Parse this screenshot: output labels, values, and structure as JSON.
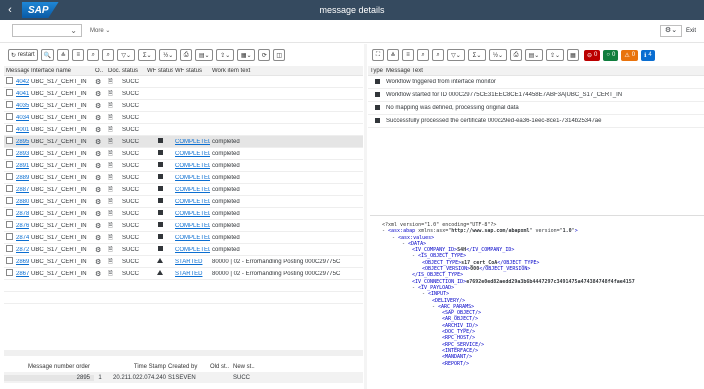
{
  "shell": {
    "title": "message details",
    "logo": "SAP",
    "back": "‹"
  },
  "subbar": {
    "dropdown_value": "",
    "more_label": "More",
    "exit_label": "Exit"
  },
  "left_toolbar": {
    "restart_label": "restart"
  },
  "grid": {
    "headers": [
      "Message",
      "Interface name",
      "O..",
      "Doc.",
      "status",
      "WF status",
      "WF status",
      "Work item text"
    ],
    "rows": [
      {
        "msg": "4042",
        "iface": "UBC_S17_CERT_IN",
        "status": "SUCC",
        "wf": "",
        "wfs": "",
        "text": "",
        "sel": false
      },
      {
        "msg": "4041",
        "iface": "UBC_S17_CERT_IN",
        "status": "SUCC",
        "wf": "",
        "wfs": "",
        "text": "",
        "sel": false
      },
      {
        "msg": "4035",
        "iface": "UBC_S17_CERT_IN",
        "status": "SUCC",
        "wf": "",
        "wfs": "",
        "text": "",
        "sel": false
      },
      {
        "msg": "4034",
        "iface": "UBC_S17_CERT_IN",
        "status": "SUCC",
        "wf": "",
        "wfs": "",
        "text": "",
        "sel": false
      },
      {
        "msg": "4001",
        "iface": "UBC_S17_CERT_IN",
        "status": "SUCC",
        "wf": "",
        "wfs": "",
        "text": "",
        "sel": false
      },
      {
        "msg": "2895",
        "iface": "UBC_S17_CERT_IN",
        "status": "SUCC",
        "wf": "sq",
        "wfs": "COMPLETED",
        "text": "completed",
        "sel": true
      },
      {
        "msg": "2893",
        "iface": "UBC_S17_CERT_IN",
        "status": "SUCC",
        "wf": "sq",
        "wfs": "COMPLETED",
        "text": "completed",
        "sel": false
      },
      {
        "msg": "2891",
        "iface": "UBC_S17_CERT_IN",
        "status": "SUCC",
        "wf": "sq",
        "wfs": "COMPLETED",
        "text": "completed",
        "sel": false
      },
      {
        "msg": "2889",
        "iface": "UBC_S17_CERT_IN",
        "status": "SUCC",
        "wf": "sq",
        "wfs": "COMPLETED",
        "text": "completed",
        "sel": false
      },
      {
        "msg": "2887",
        "iface": "UBC_S17_CERT_IN",
        "status": "SUCC",
        "wf": "sq",
        "wfs": "COMPLETED",
        "text": "completed",
        "sel": false
      },
      {
        "msg": "2880",
        "iface": "UBC_S17_CERT_IN",
        "status": "SUCC",
        "wf": "sq",
        "wfs": "COMPLETED",
        "text": "completed",
        "sel": false
      },
      {
        "msg": "2878",
        "iface": "UBC_S17_CERT_IN",
        "status": "SUCC",
        "wf": "sq",
        "wfs": "COMPLETED",
        "text": "completed",
        "sel": false
      },
      {
        "msg": "2876",
        "iface": "UBC_S17_CERT_IN",
        "status": "SUCC",
        "wf": "sq",
        "wfs": "COMPLETED",
        "text": "completed",
        "sel": false
      },
      {
        "msg": "2874",
        "iface": "UBC_S17_CERT_IN",
        "status": "SUCC",
        "wf": "sq",
        "wfs": "COMPLETED",
        "text": "completed",
        "sel": false
      },
      {
        "msg": "2872",
        "iface": "UBC_S17_CERT_IN",
        "status": "SUCC",
        "wf": "sq",
        "wfs": "COMPLETED",
        "text": "completed",
        "sel": false
      },
      {
        "msg": "2869",
        "iface": "UBC_S17_CERT_IN",
        "status": "SUCC",
        "wf": "tri",
        "wfs": "STARTED",
        "text": "80000 | 02 - Errorhandling Posting 000C29775C",
        "sel": false
      },
      {
        "msg": "2867",
        "iface": "UBC_S17_CERT_IN",
        "status": "SUCC",
        "wf": "tri",
        "wfs": "STARTED",
        "text": "80000 | 02 - Errorhandling Posting 000C29775C",
        "sel": false
      }
    ]
  },
  "summary": {
    "headers": [
      "Message number order",
      "Time Stamp",
      "Created by",
      "Old st..",
      "New st.."
    ],
    "row": {
      "num": "2895",
      "order": "1",
      "ts": "20.211.022.074.240",
      "user": "S1SEVEN",
      "old": "",
      "new": "SUCC"
    }
  },
  "right_toolbar": {
    "badges": [
      {
        "icon": "⊖",
        "count": "0",
        "color": "#bb0000"
      },
      {
        "icon": "○",
        "count": "0",
        "color": "#107e3e"
      },
      {
        "icon": "⚠",
        "count": "0",
        "color": "#e9730c"
      },
      {
        "icon": "ℹ",
        "count": "4",
        "color": "#0a6ed1"
      }
    ]
  },
  "messages": {
    "headers": [
      "Type",
      "Message Text"
    ],
    "rows": [
      "Workflow triggered from interface monitor",
      "Workflow started for ID 000C29775CE31EEC8CE174458E7ABF3A|UBC_S17_CERT_IN",
      "No mapping was defined, processing original data",
      "Successfully processed the certificate 000c29ed-ea36-1eec-8ce1-7314b25347ae"
    ]
  },
  "xml": {
    "lines": [
      {
        "indent": 0,
        "html": "<span class='pi'>&lt;?xml version=\"1.0\" encoding=\"UTF-8\"?&gt;</span>"
      },
      {
        "indent": 0,
        "html": "- <span class='t'>&lt;asx:abap</span> xmlns:asx=\"<b>http://www.sap.com/abapxml</b>\" version=\"<b>1.0</b>\"<span class='t'>&gt;</span>"
      },
      {
        "indent": 1,
        "html": "- <span class='t'>&lt;asx:values&gt;</span>"
      },
      {
        "indent": 2,
        "html": "- <span class='t'>&lt;DATA&gt;</span>"
      },
      {
        "indent": 3,
        "html": "<span class='t'>&lt;IV_COMPANY_ID&gt;</span><b>S4H</b><span class='t'>&lt;/IV_COMPANY_ID&gt;</span>"
      },
      {
        "indent": 3,
        "html": "- <span class='t'>&lt;IS_OBJECT_TYPE&gt;</span>"
      },
      {
        "indent": 4,
        "html": "<span class='t'>&lt;OBJECT_TYPE&gt;</span><b>s17_cert_CoA</b><span class='t'>&lt;/OBJECT_TYPE&gt;</span>"
      },
      {
        "indent": 4,
        "html": "<span class='t'>&lt;OBJECT_VERSION&gt;</span><b>000</b><span class='t'>&lt;/OBJECT_VERSION&gt;</span>"
      },
      {
        "indent": 3,
        "html": "<span class='t'>&lt;/IS_OBJECT_TYPE&gt;</span>"
      },
      {
        "indent": 3,
        "html": "<span class='t'>&lt;IV_CONNECTION_ID&gt;</span><b>e7692e0ed82aedd29a3b6b4447297c3491475a474384748f4fae4157</b>"
      },
      {
        "indent": 3,
        "html": "- <span class='t'>&lt;IV_PAYLOAD&gt;</span>"
      },
      {
        "indent": 4,
        "html": "- <span class='t'>&lt;INPUT&gt;</span>"
      },
      {
        "indent": 5,
        "html": "<span class='t'>&lt;DELIVERY/&gt;</span>"
      },
      {
        "indent": 5,
        "html": "- <span class='t'>&lt;ARC_PARAMS&gt;</span>"
      },
      {
        "indent": 6,
        "html": "<span class='t'>&lt;SAP_OBJECT/&gt;</span>"
      },
      {
        "indent": 6,
        "html": "<span class='t'>&lt;AR_OBJECT/&gt;</span>"
      },
      {
        "indent": 6,
        "html": "<span class='t'>&lt;ARCHIV_ID/&gt;</span>"
      },
      {
        "indent": 6,
        "html": "<span class='t'>&lt;DOC_TYPE/&gt;</span>"
      },
      {
        "indent": 6,
        "html": "<span class='t'>&lt;RPC_HOST/&gt;</span>"
      },
      {
        "indent": 6,
        "html": "<span class='t'>&lt;RPC_SERVICE/&gt;</span>"
      },
      {
        "indent": 6,
        "html": "<span class='t'>&lt;INTERFACE/&gt;</span>"
      },
      {
        "indent": 6,
        "html": "<span class='t'>&lt;MANDANT/&gt;</span>"
      },
      {
        "indent": 6,
        "html": "<span class='t'>&lt;REPORT/&gt;</span>"
      }
    ]
  }
}
